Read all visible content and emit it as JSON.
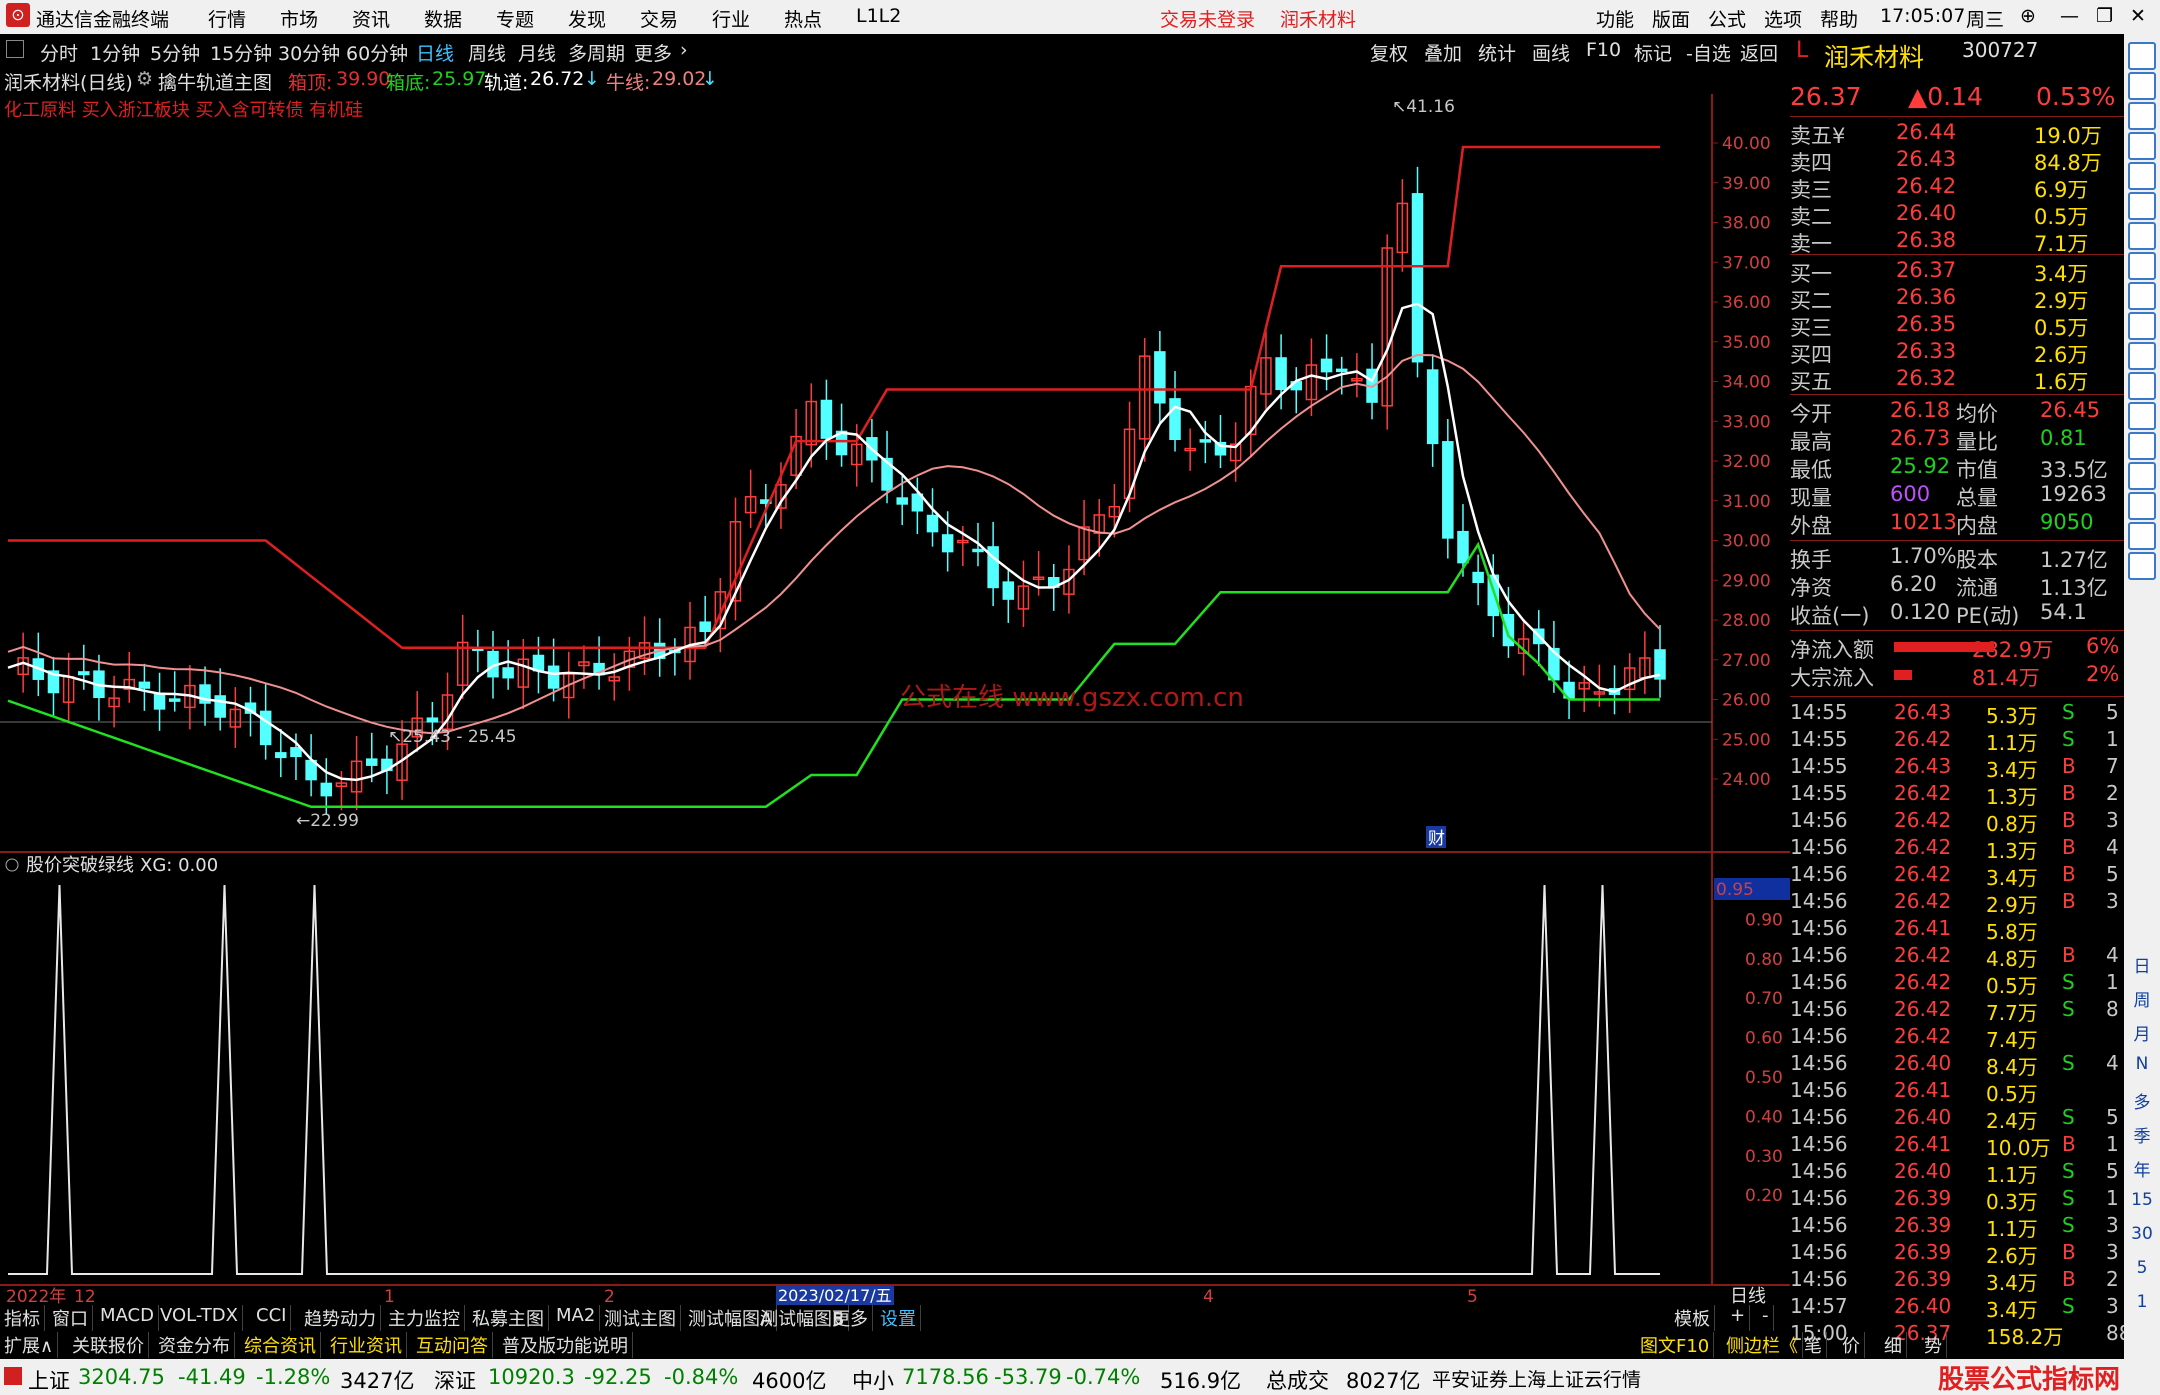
{
  "titlebar": {
    "app_title": "通达信金融终端",
    "menu": [
      "行情",
      "市场",
      "资讯",
      "数据",
      "专题",
      "发现",
      "交易",
      "行业",
      "热点",
      "L1L2"
    ],
    "trade_status": "交易未登录",
    "stock_name": "润禾材料",
    "right_menu": [
      "功能",
      "版面",
      "公式",
      "选项",
      "帮助"
    ],
    "time": "17:05:07",
    "weekday": "周三"
  },
  "periods": [
    "分时",
    "1分钟",
    "5分钟",
    "15分钟",
    "30分钟",
    "60分钟",
    "日线",
    "周线",
    "月线",
    "多周期",
    "更多"
  ],
  "active_period": "日线",
  "toolbar_right": [
    "复权",
    "叠加",
    "统计",
    "画线",
    "F10",
    "标记",
    "-自选",
    "返回"
  ],
  "infobar": {
    "stock": "润禾材料(日线)",
    "indicator": "擒牛轨道主图",
    "items": [
      {
        "label": "箱顶:",
        "value": "39.90",
        "color": "#e03030"
      },
      {
        "label": "箱底:",
        "value": "25.97",
        "color": "#20d020"
      },
      {
        "label": "轨道:",
        "value": "26.72",
        "color": "#ffffff"
      },
      {
        "label": "牛线:",
        "value": "29.02",
        "color": "#f0a0a0"
      }
    ],
    "concept": "化工原料 买入浙江板块 买入含可转债 有机硅"
  },
  "chart_data": {
    "type": "candlestick",
    "price_axis": [
      "40.00",
      "39.00",
      "38.00",
      "37.00",
      "36.00",
      "35.00",
      "34.00",
      "33.00",
      "32.00",
      "31.00",
      "30.00",
      "29.00",
      "28.00",
      "27.00",
      "26.00",
      "25.00",
      "24.00"
    ],
    "annotations": {
      "high": "41.16",
      "low": "22.99",
      "range": "25.43 - 25.45"
    },
    "x_labels": [
      "2022年",
      "12",
      "1",
      "2",
      "2023/02/17/五",
      "4",
      "5"
    ],
    "watermark": "公式在线 www.gszx.com.cn",
    "fin_marker": "财",
    "sub_title": "股价突破绿线",
    "sub_value": "XG: 0.00",
    "sub_axis": [
      "0.95",
      "0.90",
      "0.80",
      "0.70",
      "0.60",
      "0.50",
      "0.40",
      "0.30",
      "0.20"
    ],
    "sub_peaks_label": "XG",
    "period_label": "日线"
  },
  "quote": {
    "code_prefix": "L",
    "name": "润禾材料",
    "code": "300727",
    "price": "26.37",
    "change": "▲0.14",
    "pct": "0.53%",
    "asks": [
      {
        "label": "卖五¥",
        "price": "26.44",
        "vol": "19.0万"
      },
      {
        "label": "卖四",
        "price": "26.43",
        "vol": "84.8万"
      },
      {
        "label": "卖三",
        "price": "26.42",
        "vol": "6.9万"
      },
      {
        "label": "卖二",
        "price": "26.40",
        "vol": "0.5万"
      },
      {
        "label": "卖一",
        "price": "26.38",
        "vol": "7.1万"
      }
    ],
    "bids": [
      {
        "label": "买一",
        "price": "26.37",
        "vol": "3.4万"
      },
      {
        "label": "买二",
        "price": "26.36",
        "vol": "2.9万"
      },
      {
        "label": "买三",
        "price": "26.35",
        "vol": "0.5万"
      },
      {
        "label": "买四",
        "price": "26.33",
        "vol": "2.6万"
      },
      {
        "label": "买五",
        "price": "26.32",
        "vol": "1.6万"
      }
    ],
    "stats": [
      [
        "今开",
        "26.18",
        "均价",
        "26.45"
      ],
      [
        "最高",
        "26.73",
        "量比",
        "0.81"
      ],
      [
        "最低",
        "25.92",
        "市值",
        "33.5亿"
      ],
      [
        "现量",
        "600",
        "总量",
        "19263"
      ],
      [
        "外盘",
        "10213",
        "内盘",
        "9050"
      ]
    ],
    "stats2": [
      [
        "换手",
        "1.70%",
        "股本",
        "1.27亿"
      ],
      [
        "净资",
        "6.20",
        "流通",
        "1.13亿"
      ],
      [
        "收益(一)",
        "0.120",
        "PE(动)",
        "54.1"
      ]
    ],
    "flows": [
      {
        "label": "净流入额",
        "value": "282.9万",
        "pct": "6%"
      },
      {
        "label": "大宗流入",
        "value": "81.4万",
        "pct": "2%"
      }
    ],
    "ticks": [
      [
        "14:55",
        "26.43",
        "5.3万",
        "S",
        "5"
      ],
      [
        "14:55",
        "26.42",
        "1.1万",
        "S",
        "1"
      ],
      [
        "14:55",
        "26.43",
        "3.4万",
        "B",
        "7"
      ],
      [
        "14:55",
        "26.42",
        "1.3万",
        "B",
        "2"
      ],
      [
        "14:56",
        "26.42",
        "0.8万",
        "B",
        "3"
      ],
      [
        "14:56",
        "26.42",
        "1.3万",
        "B",
        "4"
      ],
      [
        "14:56",
        "26.42",
        "3.4万",
        "B",
        "5"
      ],
      [
        "14:56",
        "26.42",
        "2.9万",
        "B",
        "3"
      ],
      [
        "14:56",
        "26.41",
        "5.8万",
        "",
        ""
      ],
      [
        "14:56",
        "26.42",
        "4.8万",
        "B",
        "4"
      ],
      [
        "14:56",
        "26.42",
        "0.5万",
        "S",
        "1"
      ],
      [
        "14:56",
        "26.42",
        "7.7万",
        "S",
        "8"
      ],
      [
        "14:56",
        "26.42",
        "7.4万",
        "",
        ""
      ],
      [
        "14:56",
        "26.40",
        "8.4万",
        "S",
        "4"
      ],
      [
        "14:56",
        "26.41",
        "0.5万",
        "",
        ""
      ],
      [
        "14:56",
        "26.40",
        "2.4万",
        "S",
        "5"
      ],
      [
        "14:56",
        "26.41",
        "10.0万",
        "B",
        "1"
      ],
      [
        "14:56",
        "26.40",
        "1.1万",
        "S",
        "5"
      ],
      [
        "14:56",
        "26.39",
        "0.3万",
        "S",
        "1"
      ],
      [
        "14:56",
        "26.39",
        "1.1万",
        "S",
        "3"
      ],
      [
        "14:56",
        "26.39",
        "2.6万",
        "B",
        "3"
      ],
      [
        "14:56",
        "26.39",
        "3.4万",
        "B",
        "2"
      ],
      [
        "14:57",
        "26.40",
        "3.4万",
        "S",
        "3"
      ],
      [
        "15:00",
        "26.37",
        "158.2万",
        "",
        "88"
      ]
    ]
  },
  "bottom_tabs": [
    "指标",
    "窗口",
    "MACD",
    "VOL-TDX",
    "CCI",
    "趋势动力",
    "主力监控",
    "私募主图",
    "MA2",
    "测试主图",
    "测试幅图A",
    "测试幅图B",
    "更多",
    "设置"
  ],
  "bottom_tabs2": [
    "扩展∧",
    "关联报价",
    "资金分布",
    "综合资讯",
    "行业资讯",
    "互动问答",
    "普及版功能说明"
  ],
  "bottom_right": [
    "模板",
    "+",
    "-"
  ],
  "f10_links": [
    "图文F10",
    "侧边栏《",
    "笔",
    "价",
    "细",
    "势"
  ],
  "status": {
    "sh_label": "上证",
    "sh_value": "3204.75",
    "sh_chg": "-41.49",
    "sh_pct": "-1.28%",
    "sh_amt": "3427亿",
    "sz_label": "深证",
    "sz_value": "10920.3",
    "sz_chg": "-92.25",
    "sz_pct": "-0.84%",
    "sz_amt": "4600亿",
    "zx_label": "中小",
    "zx_value": "7178.56",
    "zx_chg": "-53.79",
    "zx_pct": "-0.74%",
    "zx_amt": "516.9亿",
    "total_label": "总成交",
    "total_amt": "8027亿",
    "broker": "平安证券上海上证云行情",
    "brand": "股票公式指标网",
    "brand_url": "www.gszx.com.cn"
  },
  "side_icons": [
    "日",
    "周",
    "月",
    "N",
    "多",
    "季",
    "年",
    "15",
    "30",
    "5",
    "1"
  ]
}
